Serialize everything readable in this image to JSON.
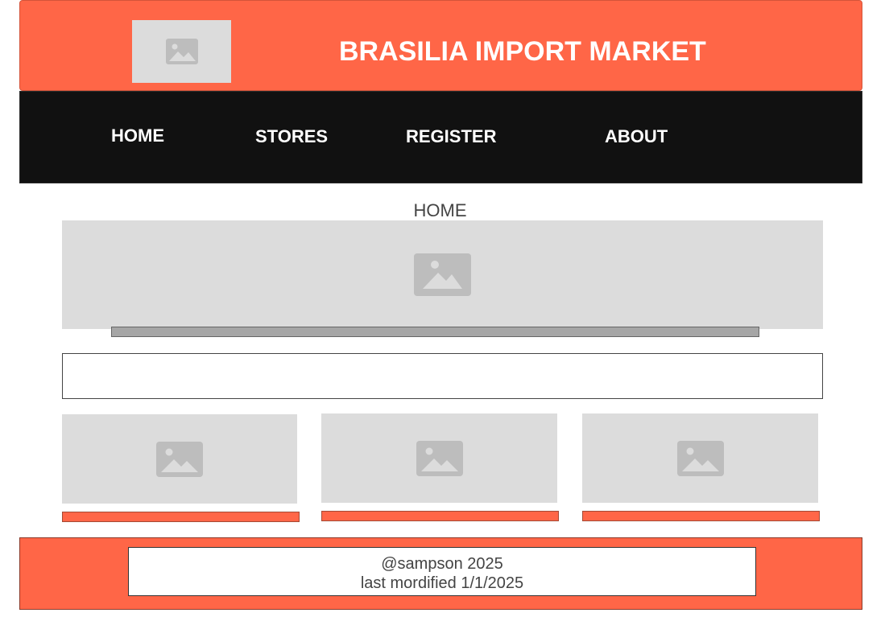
{
  "header": {
    "title": "BRASILIA IMPORT MARKET",
    "logo_icon": "image-placeholder-icon",
    "bg_color": "#ff6647"
  },
  "nav": {
    "items": [
      {
        "label": "HOME"
      },
      {
        "label": "STORES"
      },
      {
        "label": "REGISTER"
      },
      {
        "label": "ABOUT"
      }
    ]
  },
  "main": {
    "page_heading": "HOME",
    "hero_icon": "image-placeholder-icon",
    "cards": [
      {
        "icon": "image-placeholder-icon"
      },
      {
        "icon": "image-placeholder-icon"
      },
      {
        "icon": "image-placeholder-icon"
      }
    ]
  },
  "footer": {
    "line1": "@sampson 2025",
    "line2": "last mordified 1/1/2025"
  }
}
